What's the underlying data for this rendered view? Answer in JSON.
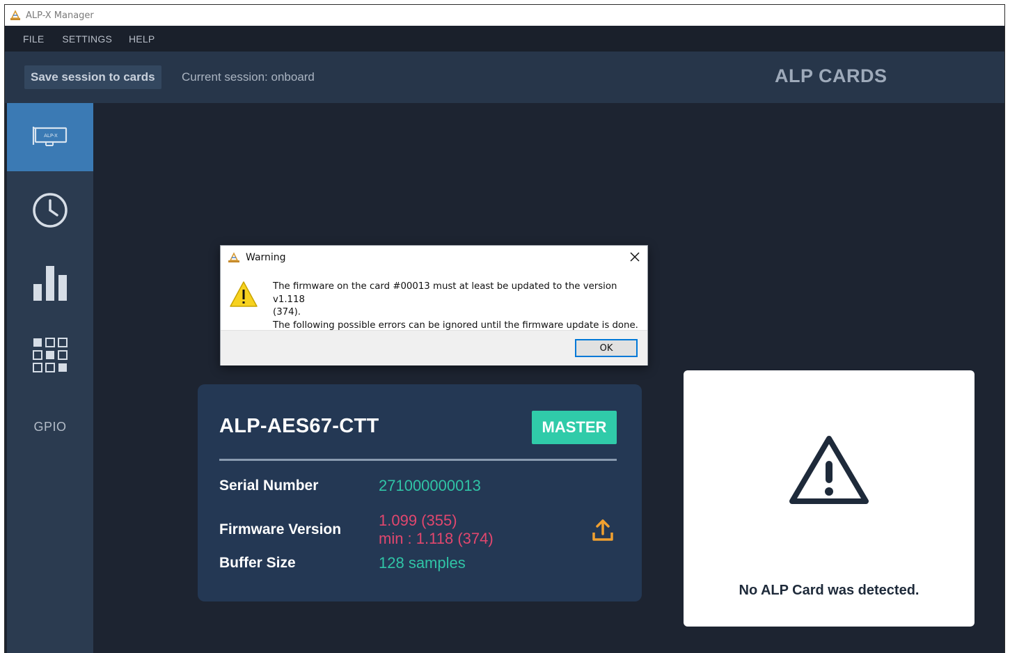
{
  "window": {
    "title": "ALP-X Manager",
    "app_icon": "alp-logo-icon"
  },
  "menu": {
    "items": [
      "FILE",
      "SETTINGS",
      "HELP"
    ]
  },
  "toolbar": {
    "save_label": "Save session to cards",
    "session_text": "Current session: onboard",
    "section_title": "ALP CARDS"
  },
  "sidebar": {
    "items": [
      {
        "icon": "alp-card-icon",
        "active": true
      },
      {
        "icon": "clock-icon",
        "active": false
      },
      {
        "icon": "bar-chart-icon",
        "active": false
      },
      {
        "icon": "grid-matrix-icon",
        "active": false
      },
      {
        "label": "GPIO",
        "active": false
      }
    ],
    "card_icon_text": "ALP-X"
  },
  "card": {
    "name": "ALP-AES67-CTT",
    "badge": "MASTER",
    "serial_label": "Serial Number",
    "serial_value": "271000000013",
    "firmware_label": "Firmware Version",
    "firmware_value": "1.099 (355)",
    "firmware_min": "min : 1.118 (374)",
    "buffer_label": "Buffer Size",
    "buffer_value": "128 samples",
    "upload_icon": "upload-icon"
  },
  "no_card": {
    "message": "No ALP Card was detected.",
    "icon": "warning-triangle-icon"
  },
  "dialog": {
    "title": "Warning",
    "line1": "The firmware on the card  #00013 must at least be updated to the version v1.118",
    "line2": "(374).",
    "line3": "The following possible errors can be ignored until the firmware update is done.",
    "ok_label": "OK"
  },
  "colors": {
    "accent_teal": "#30cba9",
    "error_red": "#e2476e",
    "active_blue": "#3b7ab4"
  }
}
